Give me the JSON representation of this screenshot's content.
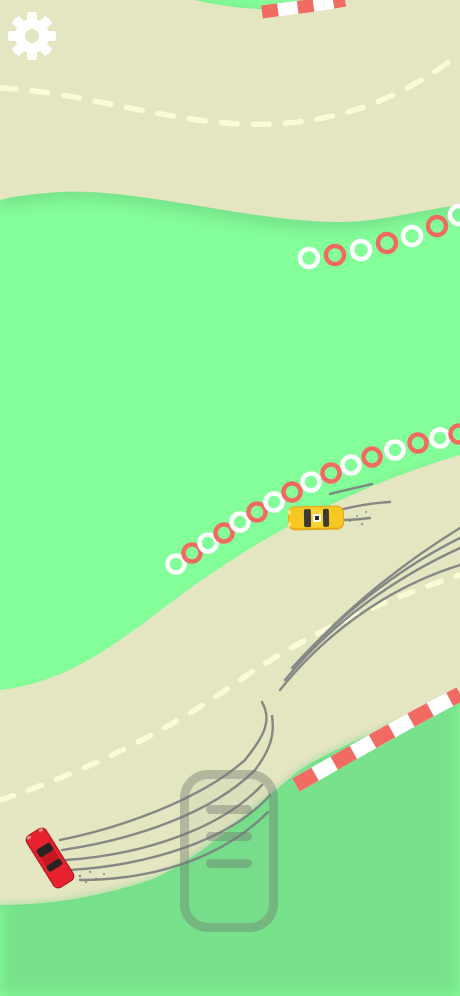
{
  "game": {
    "colors": {
      "grass": "#84fe98",
      "road": "#e4e5c1",
      "road_shadow": "#7ae48e",
      "lane_dash": "#fafad6",
      "curb_red": "#f26b62",
      "curb_white": "#ffffff",
      "tire_marks": "#7b7f7e",
      "player_car": "#e8212f",
      "opponent_car": "#f7c821"
    },
    "controls": {
      "settings_icon": "gear-icon",
      "drift_button_icon": "drift-pad-icon"
    },
    "cars": [
      {
        "role": "player",
        "color": "red"
      },
      {
        "role": "opponent",
        "color": "yellow",
        "type": "taxi"
      }
    ]
  }
}
